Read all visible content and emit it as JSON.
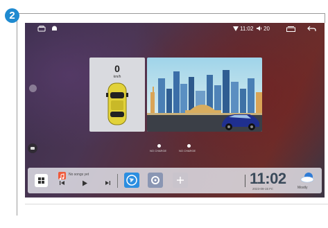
{
  "step_badge": "2",
  "status": {
    "time": "11:02",
    "volume": "20"
  },
  "speed": {
    "value": "0",
    "unit": "km/h"
  },
  "indicators": {
    "left_label": "NO CHARGE",
    "right_label": "NO CHARGE"
  },
  "dock": {
    "song_title": "No songs yet",
    "clock": "11:02",
    "date": "2023-09-15 Fri",
    "weather": "Mostly"
  },
  "colors": {
    "accent_blue": "#2b8ee0",
    "music_orange": "#ef5a3b",
    "badge_blue": "#1f8ad0"
  },
  "icons": [
    "home-icon",
    "android-icon",
    "wifi-icon",
    "volume-icon",
    "recent-apps-icon",
    "back-icon",
    "car-icon",
    "grid-icon",
    "music-note-icon",
    "prev-icon",
    "play-icon",
    "next-icon",
    "globe-icon",
    "settings-icon",
    "plus-icon",
    "cloud-icon"
  ]
}
